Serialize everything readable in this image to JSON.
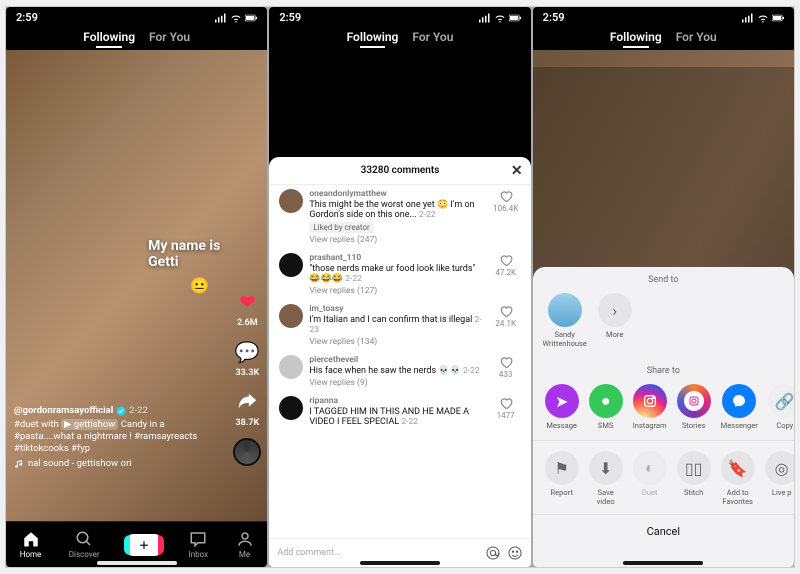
{
  "status": {
    "time": "2:59"
  },
  "tabs": {
    "following": "Following",
    "foryou": "For You"
  },
  "feed1": {
    "overlay": "My name is\nGetti",
    "username": "@gordonramsayofficial",
    "date": "2-22",
    "caption_prefix": "#duet with",
    "caption_tag": "gettishow",
    "caption_rest": "Candy in a #pasta....what a nightmare ! #ramsayreacts #tiktokcooks #fyp",
    "sound": "nal sound - gettishow   ori",
    "like_count": "2.6M",
    "comment_count": "33.3K",
    "share_count": "38.7K"
  },
  "nav": {
    "home": "Home",
    "discover": "Discover",
    "inbox": "Inbox",
    "me": "Me"
  },
  "comments": {
    "header": "33280 comments",
    "add_placeholder": "Add comment...",
    "liked_by_creator": "Liked by creator",
    "items": [
      {
        "user": "oneandonlymatthew",
        "text": "This might be the worst one yet 😳 I'm on Gordon's side on this one...",
        "date": "2-22",
        "likes": "106.4K",
        "replies": "View replies (247)",
        "liked_by_creator": true
      },
      {
        "user": "prashant_110",
        "text": "\"those nerds make ur food look like turds\" 😂😂😂",
        "date": "2-22",
        "likes": "47.2K",
        "replies": "View replies (127)"
      },
      {
        "user": "im_toasy",
        "text": "I'm Italian and I can confirm that is illegal",
        "date": "2-23",
        "likes": "24.1K",
        "replies": "View replies (134)"
      },
      {
        "user": "piercetheveil",
        "text": "His face when he saw the nerds 💀💀",
        "date": "2-22",
        "likes": "433",
        "replies": "View replies (9)"
      },
      {
        "user": "ripanna",
        "text": "I TAGGED HIM IN THIS AND HE MADE A VIDEO I FEEL SPECIAL",
        "date": "2-22",
        "likes": "1477",
        "replies": ""
      }
    ]
  },
  "share": {
    "send_to": "Send to",
    "share_to": "Share to",
    "contact": "Sandy Writtenhouse",
    "more": "More",
    "options": {
      "message": "Message",
      "sms": "SMS",
      "instagram": "Instagram",
      "stories": "Stories",
      "messenger": "Messenger",
      "copy": "Copy"
    },
    "actions": {
      "report": "Report",
      "save": "Save video",
      "duet": "Duet",
      "stitch": "Stitch",
      "fav": "Add to Favorites",
      "live": "Live p"
    },
    "cancel": "Cancel"
  }
}
